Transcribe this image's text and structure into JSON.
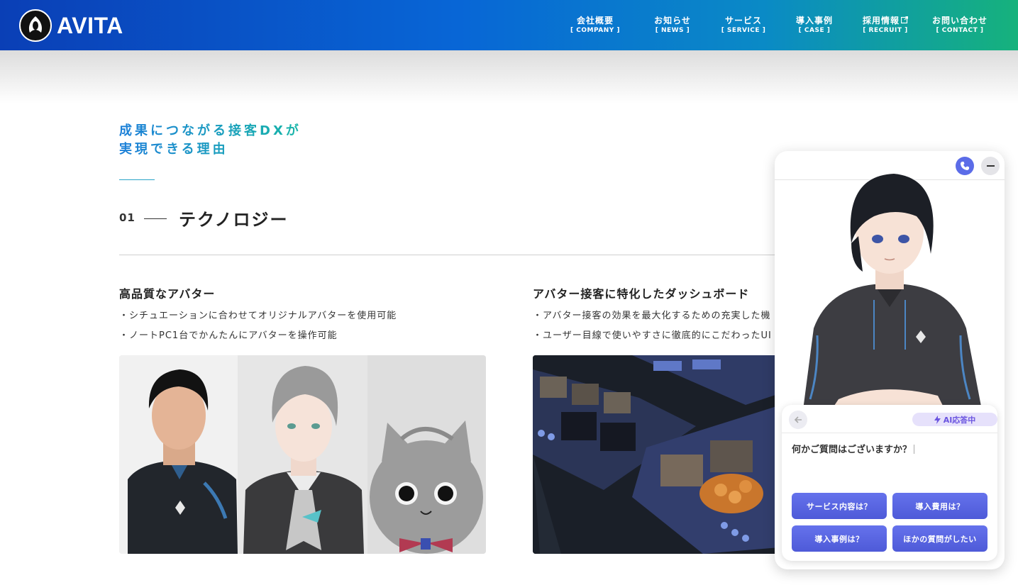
{
  "header": {
    "brand": "AVITA",
    "nav": [
      {
        "ja": "会社概要",
        "en": "[ COMPANY ]"
      },
      {
        "ja": "お知らせ",
        "en": "[ NEWS ]"
      },
      {
        "ja": "サービス",
        "en": "[ SERVICE ]"
      },
      {
        "ja": "導入事例",
        "en": "[ CASE ]"
      },
      {
        "ja": "採用情報",
        "en": "[ RECRUIT ]"
      },
      {
        "ja": "お問い合わせ",
        "en": "[ CONTACT ]"
      }
    ],
    "recruit_icon": "external-link-icon"
  },
  "section": {
    "heading_line1": "成果につながる接客DXが",
    "heading_line2": "実現できる理由"
  },
  "technology": {
    "number": "01",
    "title": "テクノロジー"
  },
  "features": [
    {
      "title": "高品質なアバター",
      "bullets": [
        "・シチュエーションに合わせてオリジナルアバターを使用可能",
        "・ノートPC1台でかんたんにアバターを操作可能"
      ]
    },
    {
      "title": "アバター接客に特化したダッシュボード",
      "bullets": [
        "・アバター接客の効果を最大化するための充実した機",
        "・ユーザー目線で使いやすさに徹底的にこだわったUI"
      ]
    }
  ],
  "chat_widget": {
    "ai_badge": "AI応答中",
    "message": "何かご質問はございますか？",
    "quick_replies": [
      "サービス内容は？",
      "導入費用は？",
      "導入事例は？",
      "ほかの質問がしたい"
    ],
    "icons": {
      "call": "phone-icon",
      "minimize": "minus-icon",
      "back": "arrow-left-icon",
      "badge": "lightning-icon"
    }
  },
  "colors": {
    "header_gradient_start": "#0a3fb6",
    "header_gradient_end": "#16b27c",
    "accent_blue": "#1c7fd9",
    "accent_teal": "#18b6a8",
    "button_primary": "#5b67e6",
    "badge_bg": "#e6e1fb",
    "badge_text": "#6a54e0"
  }
}
